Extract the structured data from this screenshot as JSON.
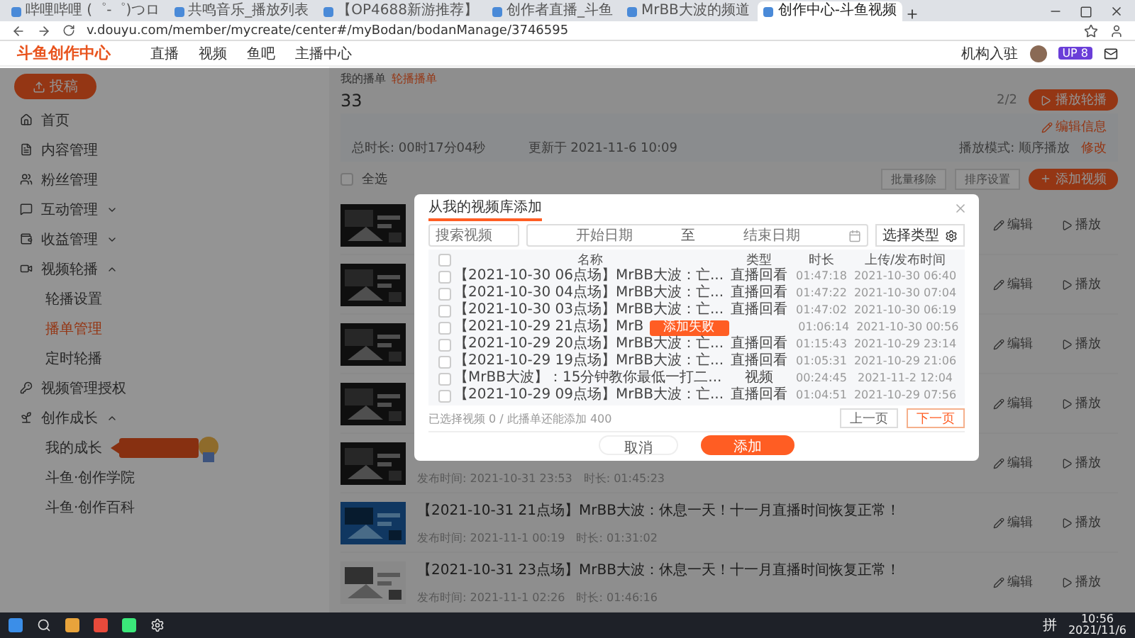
{
  "browser": {
    "tabs": [
      {
        "label": "哔哩哔哩 (゜-゜)つロ",
        "selected": false
      },
      {
        "label": "共鸣音乐_播放列表",
        "selected": false
      },
      {
        "label": "【OP4688新游推荐】",
        "selected": false
      },
      {
        "label": "创作者直播_斗鱼",
        "selected": false
      },
      {
        "label": "MrBB大波的频道",
        "selected": false
      },
      {
        "label": "创作中心-斗鱼视频",
        "selected": true
      }
    ],
    "url": "v.douyu.com/member/mycreate/center#/myBodan/bodanManage/3746595"
  },
  "header": {
    "logo": "斗鱼创作中心",
    "nav": [
      "直播",
      "视频",
      "鱼吧",
      "主播中心"
    ],
    "join": "机构入驻",
    "badge": "UP 8"
  },
  "sidebar": {
    "upload": "投稿",
    "items": [
      {
        "label": "首页"
      },
      {
        "label": "内容管理"
      },
      {
        "label": "粉丝管理"
      },
      {
        "label": "互动管理",
        "expanded": false
      },
      {
        "label": "收益管理",
        "expanded": false
      },
      {
        "label": "视频轮播",
        "expanded": true,
        "children": [
          {
            "label": "轮播设置",
            "selected": false
          },
          {
            "label": "播单管理",
            "selected": true
          },
          {
            "label": "定时轮播",
            "selected": false
          }
        ]
      },
      {
        "label": "视频管理授权"
      },
      {
        "label": "创作成长",
        "expanded": true,
        "children": [
          {
            "label": "我的成长",
            "selected": false,
            "promo": true
          },
          {
            "label": "斗鱼·创作学院",
            "selected": false
          },
          {
            "label": "斗鱼·创作百科",
            "selected": false
          }
        ]
      }
    ]
  },
  "main": {
    "breadcrumb": [
      "我的播单",
      "轮播播单"
    ],
    "title": "33",
    "count": "2/2",
    "play_button": "播放轮播",
    "info": {
      "edit": "编辑信息",
      "duration": "总时长: 00时17分04秒",
      "updated": "更新于 2021-11-6 10:09",
      "mode": "播放模式: 顺序播放",
      "modify": "修改"
    },
    "toolbar": {
      "select_all": "全选",
      "all_checked": false,
      "buttons": [
        "批量移除",
        "排序设置"
      ],
      "add": "添加视频"
    },
    "rows": [
      {
        "kind": "dark",
        "actions": [
          "编辑",
          "播放"
        ]
      },
      {
        "kind": "dark",
        "actions": [
          "编辑",
          "播放"
        ]
      },
      {
        "kind": "dark",
        "actions": [
          "编辑",
          "播放"
        ]
      },
      {
        "kind": "dark",
        "actions": [
          "编辑",
          "播放"
        ]
      },
      {
        "kind": "dark",
        "meta": "发布时间: 2021-10-31 23:53　时长: 01:45:23",
        "actions": [
          "编辑",
          "播放"
        ]
      },
      {
        "kind": "blue",
        "title": "【2021-10-31 21点场】MrBB大波：休息一天！十一月直播时间恢复正常！",
        "meta": "发布时间: 2021-11-1 00:19　时长: 01:31:02",
        "actions": [
          "编辑",
          "播放"
        ]
      },
      {
        "kind": "light",
        "title": "【2021-10-31 23点场】MrBB大波：休息一天！十一月直播时间恢复正常！",
        "meta": "发布时间: 2021-11-1 02:26　时长: 01:46:16",
        "actions": [
          "编辑",
          "播放"
        ]
      }
    ]
  },
  "modal": {
    "title": "从我的视频库添加",
    "search": {
      "placeholder": "搜索视频"
    },
    "start": {
      "placeholder": "开始日期"
    },
    "to": "至",
    "end": {
      "placeholder": "结束日期"
    },
    "type_select": "选择类型",
    "all_checked": false,
    "columns": [
      "名称",
      "类型",
      "时长",
      "上传/发布时间"
    ],
    "rows": [
      {
        "name": "【2021-10-30 06点场】MrBB大波：亡...",
        "type": "直播回看",
        "duration": "01:47:18",
        "time": "2021-10-30 06:40",
        "checked": false
      },
      {
        "name": "【2021-10-30 04点场】MrBB大波：亡...",
        "type": "直播回看",
        "duration": "01:47:22",
        "time": "2021-10-30 07:04",
        "checked": false
      },
      {
        "name": "【2021-10-30 03点场】MrBB大波：亡...",
        "type": "直播回看",
        "duration": "01:47:02",
        "time": "2021-10-30 06:19",
        "checked": false
      },
      {
        "name": "【2021-10-29 21点场】MrB",
        "toast": "添加失败",
        "duration": "01:06:14",
        "time": "2021-10-30 00:56",
        "checked": false
      },
      {
        "name": "【2021-10-29 20点场】MrBB大波：亡...",
        "type": "直播回看",
        "duration": "01:15:43",
        "time": "2021-10-29 23:14",
        "checked": false
      },
      {
        "name": "【2021-10-29 19点场】MrBB大波：亡...",
        "type": "直播回看",
        "duration": "01:05:31",
        "time": "2021-10-29 21:06",
        "checked": false
      },
      {
        "name": "【MrBB大波】：15分钟教你最低一打二...",
        "type": "视频",
        "duration": "00:24:45",
        "time": "2021-11-2 12:04",
        "checked": false
      },
      {
        "name": "【2021-10-29 09点场】MrBB大波：亡...",
        "type": "直播回看",
        "duration": "01:04:51",
        "time": "2021-10-29 07:56",
        "checked": false
      }
    ],
    "footer": "已选择视频 0 / 此播单还能添加 400",
    "prev": "上一页",
    "next": "下一页",
    "cancel": "取消",
    "confirm": "添加"
  },
  "taskbar": {
    "ime": "拼",
    "time": "10:56",
    "date": "2021/11/6"
  }
}
